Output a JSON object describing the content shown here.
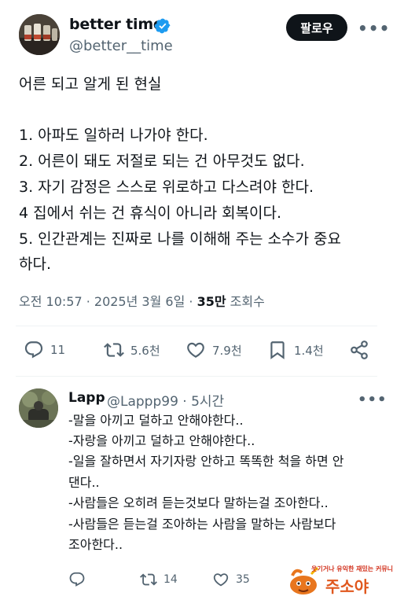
{
  "tweet": {
    "display_name": "better time",
    "handle": "@better__time",
    "follow_label": "팔로우",
    "more_label": "•••",
    "lines": [
      "어른 되고 알게 된 현실",
      "1. 아파도 일하러 나가야 한다.",
      "2. 어른이 돼도 저절로 되는 건 아무것도 없다.",
      "3. 자기 감정은 스스로 위로하고 다스려야 한다.",
      "4 집에서 쉬는 건 휴식이 아니라 회복이다.",
      "5. 인간관계는 진짜로 나를 이해해 주는 소수가 중요",
      "하다."
    ],
    "meta_time": "오전 10:57 · 2025년 3월 6일 · ",
    "views_count": "35만",
    "views_label": " 조회수",
    "actions": {
      "replies": "11",
      "retweets": "5.6천",
      "likes": "7.9천",
      "bookmarks": "1.4천"
    }
  },
  "reply": {
    "display_name": "Lapp",
    "handle_time": "@Lappp99 · 5시간",
    "more_label": "•••",
    "lines": [
      "-말을 아끼고 덜하고 안해야한다..",
      "-자랑을 아끼고 덜하고 안해야한다..",
      "-일을 잘하면서 자기자랑 안하고 똑똑한 척을 하면 안",
      "댄다..",
      "-사람들은 오히려 듣는것보다 말하는걸 조아한다..",
      "-사람들은 듣는걸 조아하는 사람을 말하는 사람보다",
      "조아한다.."
    ],
    "actions": {
      "retweets": "14",
      "likes": "35"
    }
  },
  "watermark": {
    "top_text": "웃기거나 유익한 재밌는 커뮤니티",
    "main_text": "주소야"
  },
  "colors": {
    "text": "#0f1419",
    "secondary": "#536471",
    "verified": "#1d9bf0",
    "divider": "#eff3f4"
  }
}
